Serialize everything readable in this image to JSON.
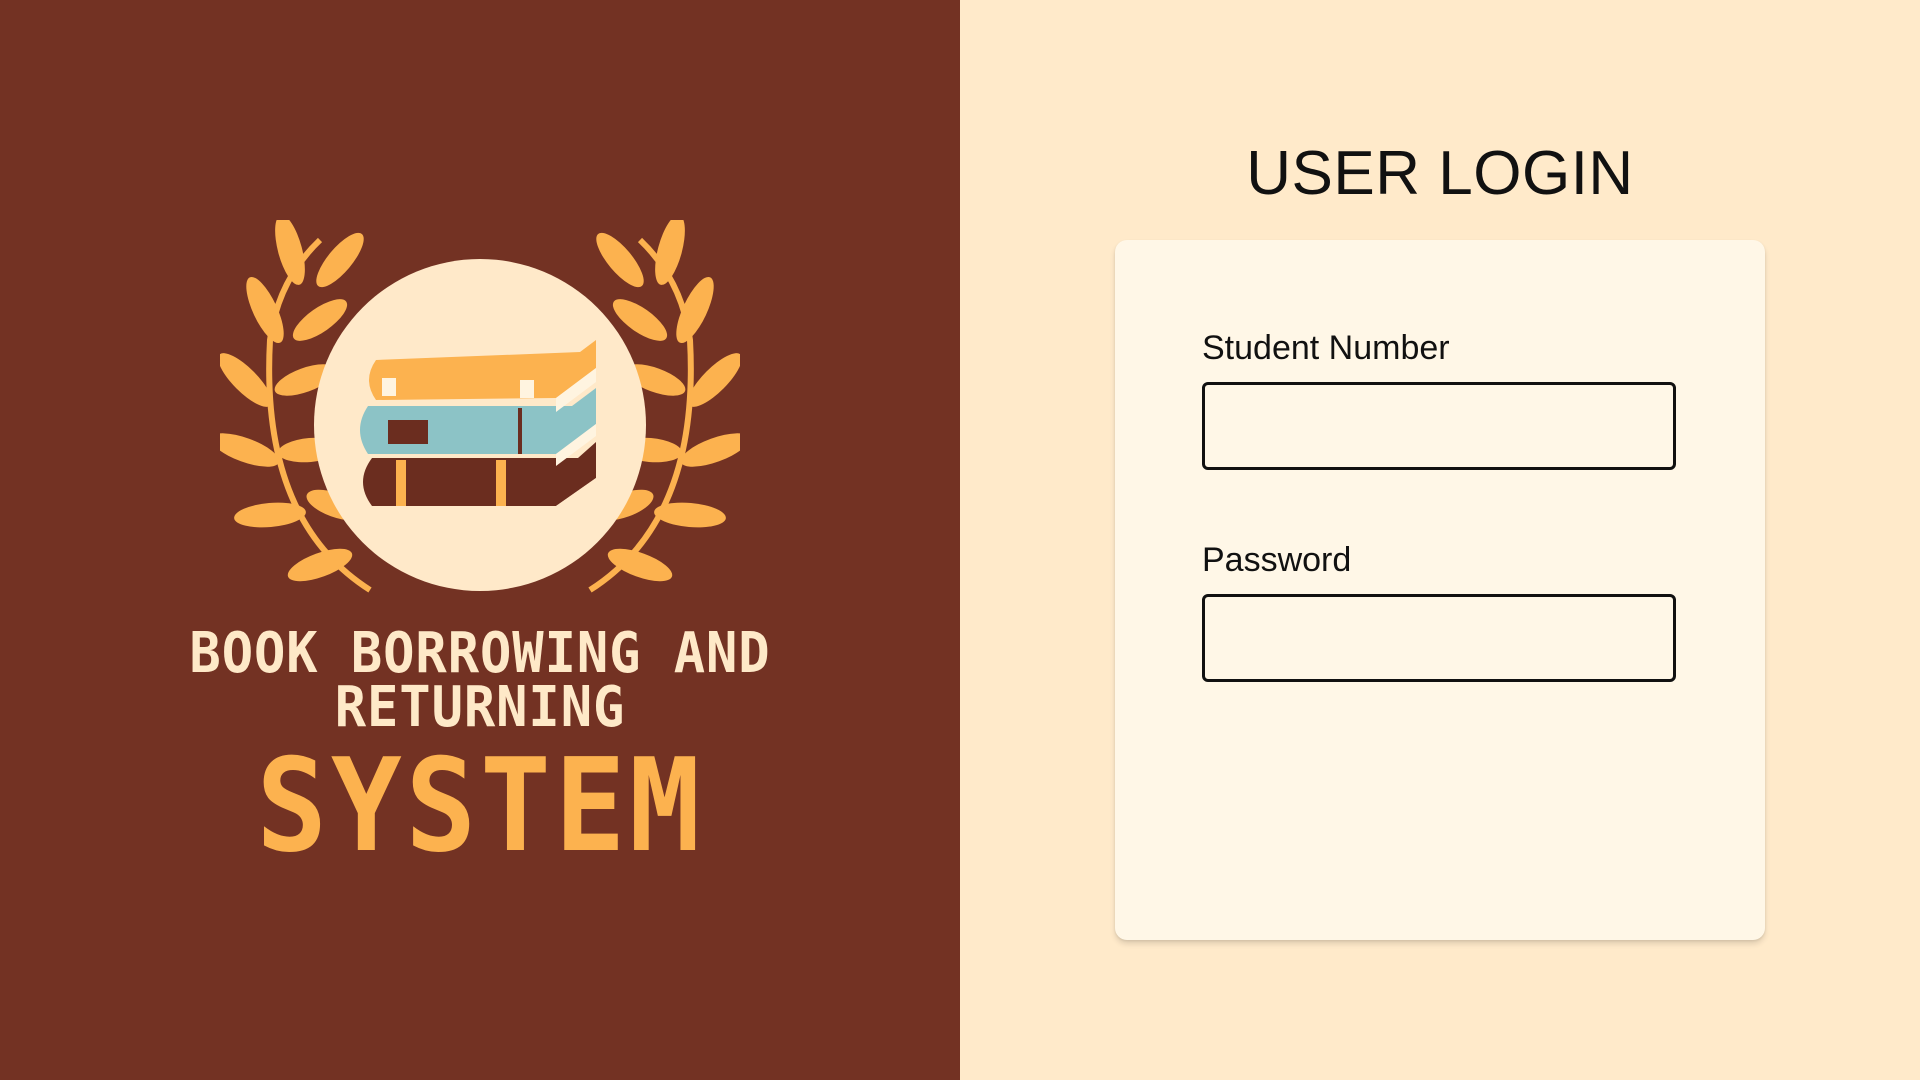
{
  "branding": {
    "line1": "BOOK BORROWING AND",
    "line2": "RETURNING",
    "line3": "SYSTEM",
    "logo_icon": "books-laurel-logo",
    "colors": {
      "panel_bg": "#733223",
      "text_light": "#FEE9C8",
      "text_accent": "#FCB24F"
    }
  },
  "login": {
    "title": "USER LOGIN",
    "student_number_label": "Student Number",
    "student_number_value": "",
    "password_label": "Password",
    "password_value": "",
    "colors": {
      "page_bg": "#FFEACA",
      "card_bg": "#FFF7E7"
    }
  }
}
